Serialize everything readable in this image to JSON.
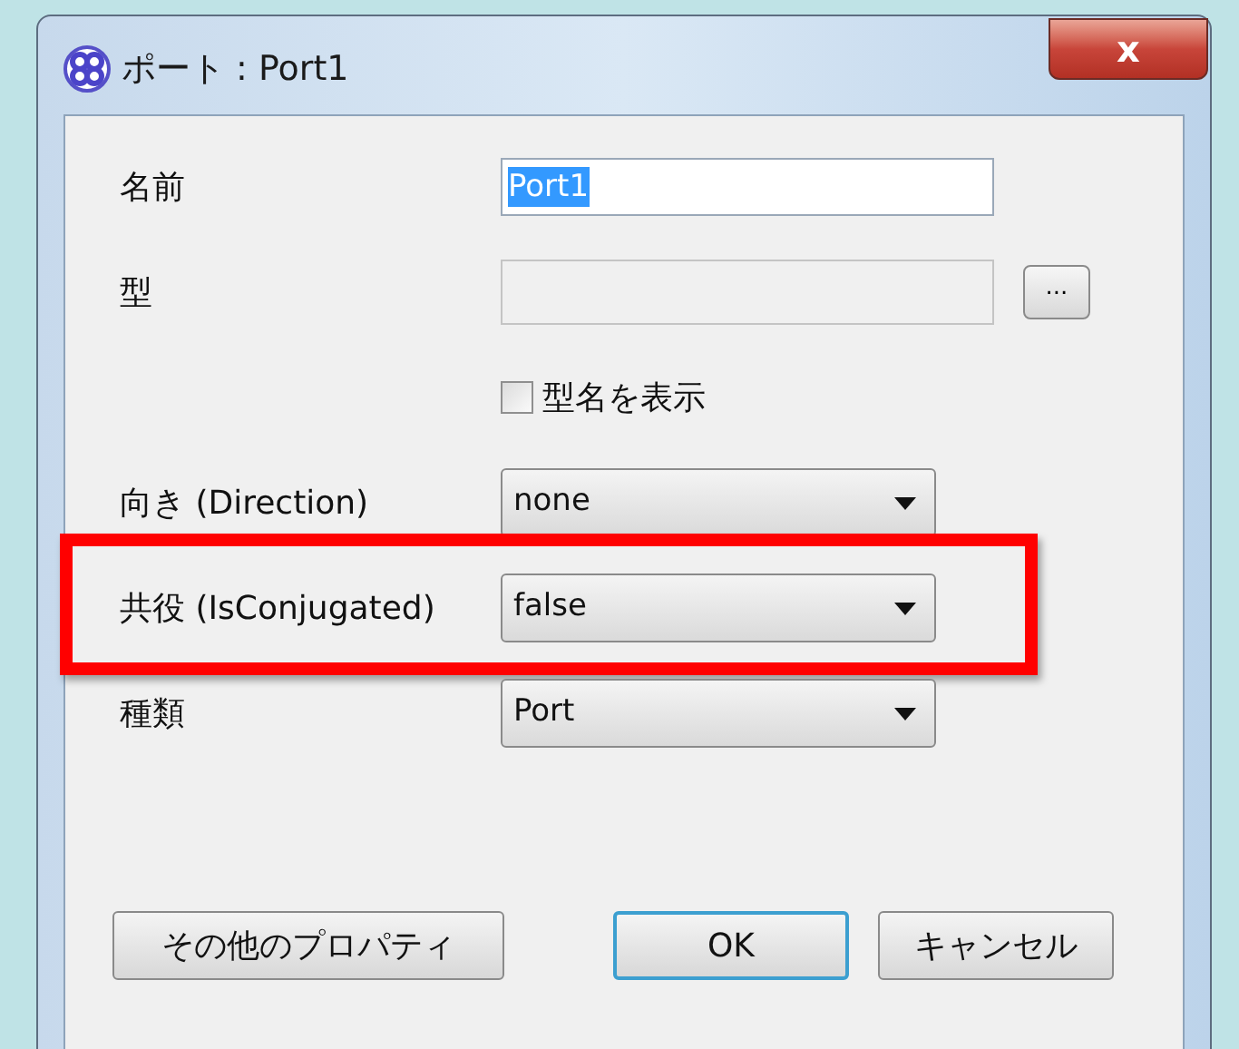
{
  "window": {
    "title": "ポート : Port1",
    "close": "x"
  },
  "rows": [
    {
      "kind": "text",
      "label": "名前",
      "value": "Port1",
      "selected_text": true,
      "highlighted": false
    },
    {
      "kind": "browse",
      "label": "型",
      "value": "",
      "button": "...",
      "highlighted": false
    },
    {
      "kind": "checkbox",
      "label": "型名を表示",
      "checked": false,
      "highlighted": false
    },
    {
      "kind": "select",
      "label": "向き (Direction)",
      "value": "none",
      "highlighted": false
    },
    {
      "kind": "select",
      "label": "共役 (IsConjugated)",
      "value": "false",
      "highlighted": true
    },
    {
      "kind": "select",
      "label": "種類",
      "value": "Port",
      "highlighted": false
    }
  ],
  "buttons": [
    {
      "label": "その他のプロパティ",
      "default": false
    },
    {
      "label": "OK",
      "default": true
    },
    {
      "label": "キャンセル",
      "default": false
    }
  ]
}
